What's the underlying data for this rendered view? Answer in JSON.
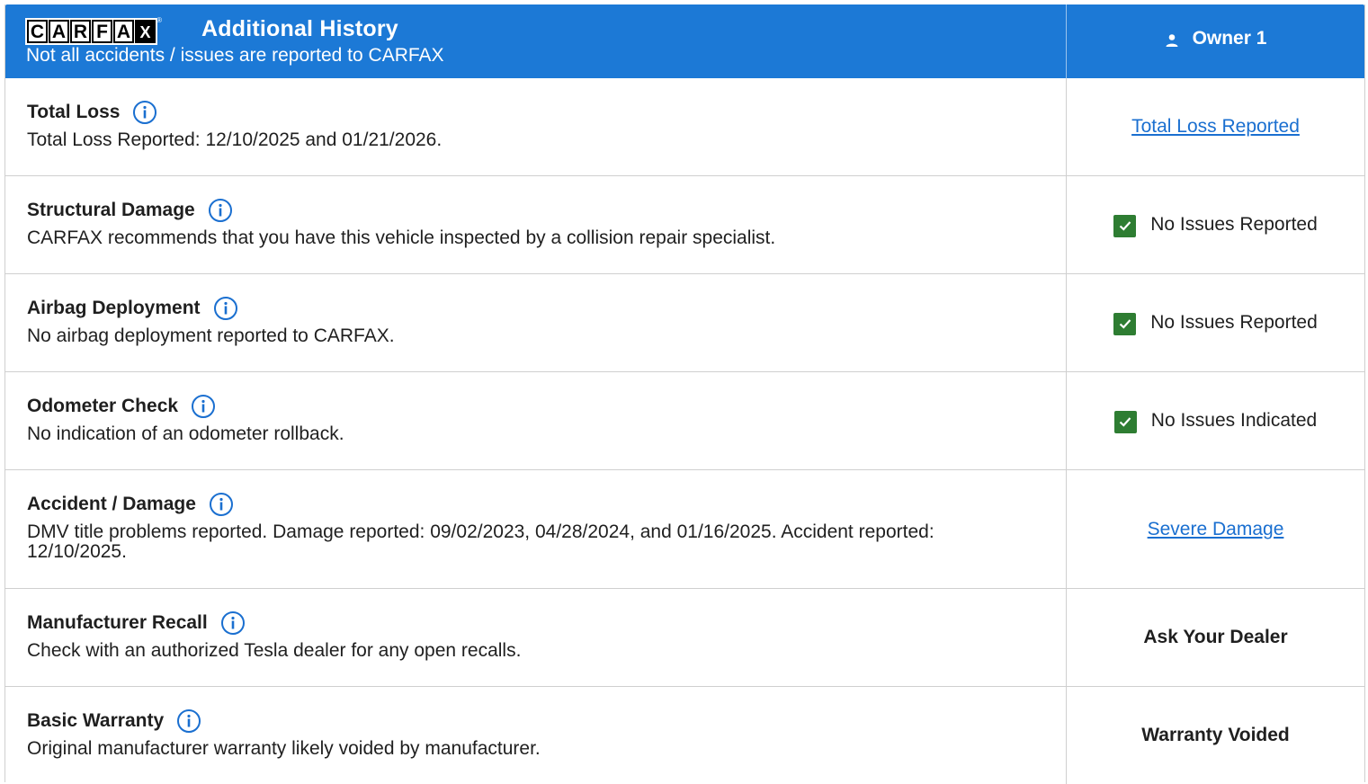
{
  "header": {
    "logo_letters": [
      "C",
      "A",
      "R",
      "F",
      "A",
      "X"
    ],
    "logo_registered": "®",
    "title": "Additional History",
    "subtitle": "Not all accidents / issues are reported to CARFAX",
    "owner_label": "Owner 1",
    "background_color": "#1c79d6"
  },
  "rows": [
    {
      "title": "Total Loss",
      "description": "Total Loss Reported: 12/10/2025 and 01/21/2026.",
      "status": "Total Loss Reported",
      "status_type": "link"
    },
    {
      "title": "Structural Damage",
      "description": "CARFAX recommends that you have this vehicle inspected by a collision repair specialist.",
      "status": "No Issues Reported",
      "status_type": "check"
    },
    {
      "title": "Airbag Deployment",
      "description": "No airbag deployment reported to CARFAX.",
      "status": "No Issues Reported",
      "status_type": "check"
    },
    {
      "title": "Odometer Check",
      "description": "No indication of an odometer rollback.",
      "status": "No Issues Indicated",
      "status_type": "check"
    },
    {
      "title": "Accident / Damage",
      "description": "DMV title problems reported. Damage reported: 09/02/2023, 04/28/2024, and 01/16/2025. Accident reported: 12/10/2025.",
      "status": "Severe Damage",
      "status_type": "link"
    },
    {
      "title": "Manufacturer Recall",
      "description": "Check with an authorized Tesla dealer for any open recalls.",
      "status": "Ask Your Dealer",
      "status_type": "bold"
    },
    {
      "title": "Basic Warranty",
      "description": "Original manufacturer warranty likely voided by manufacturer.",
      "status": "Warranty Voided",
      "status_type": "bold"
    }
  ],
  "colors": {
    "link": "#1a6fd0",
    "check": "#2e7d32",
    "info_icon": "#1a6fd0",
    "border": "#cfcfcf"
  },
  "icons": {
    "info": "info-circle-icon",
    "check": "checkbox-checked-icon",
    "owner": "person-icon"
  }
}
